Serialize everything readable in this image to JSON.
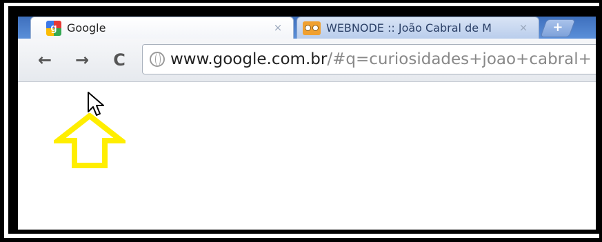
{
  "browser": {
    "tabs": [
      {
        "title": "Google",
        "close": "×",
        "icon": "google-favicon"
      },
      {
        "title": "WEBNODE :: João Cabral de M",
        "close": "×",
        "icon": "webnode-favicon"
      }
    ],
    "new_tab_label": "+",
    "nav": {
      "back": "←",
      "forward": "→",
      "reload": "C"
    },
    "address": {
      "host": "www.google.com.br",
      "rest": "/#q=curiosidades+joao+cabral+"
    }
  },
  "page": {
    "annotations": {
      "arrow": "yellow-up-arrow",
      "pointer": "mouse-pointer"
    }
  },
  "colors": {
    "arrow": "#ffee00",
    "tabstrip": "#4a7cc9"
  }
}
